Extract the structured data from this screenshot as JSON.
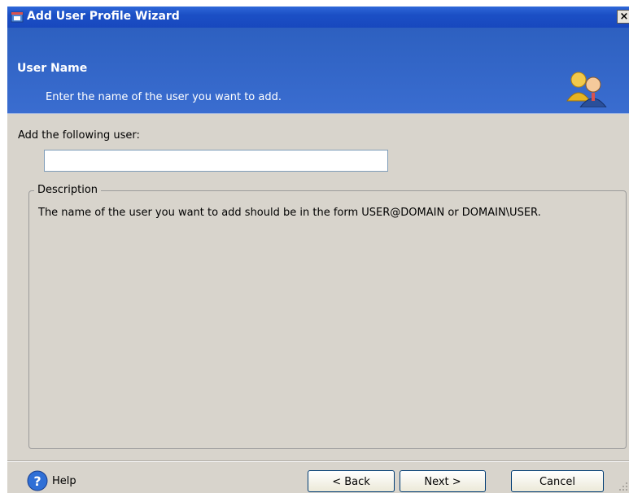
{
  "window": {
    "title": "Add User Profile Wizard",
    "close_label": "×"
  },
  "header": {
    "title": "User Name",
    "subtitle": "Enter the name of the user you want to add."
  },
  "form": {
    "add_label": "Add the following user:",
    "user_input_value": ""
  },
  "description": {
    "legend": "Description",
    "text": "The name of the user you want to add should be in the form USER@DOMAIN or DOMAIN\\USER."
  },
  "footer": {
    "help_label": "Help",
    "back_label": "< Back",
    "next_label": "Next >",
    "cancel_label": "Cancel"
  },
  "colors": {
    "title_bar": "#1b4fc5",
    "header_bg": "#3366cc",
    "dialog_bg": "#d8d4cc"
  },
  "icons": {
    "app": "app-icon",
    "header": "users-icon",
    "help": "help-icon"
  }
}
